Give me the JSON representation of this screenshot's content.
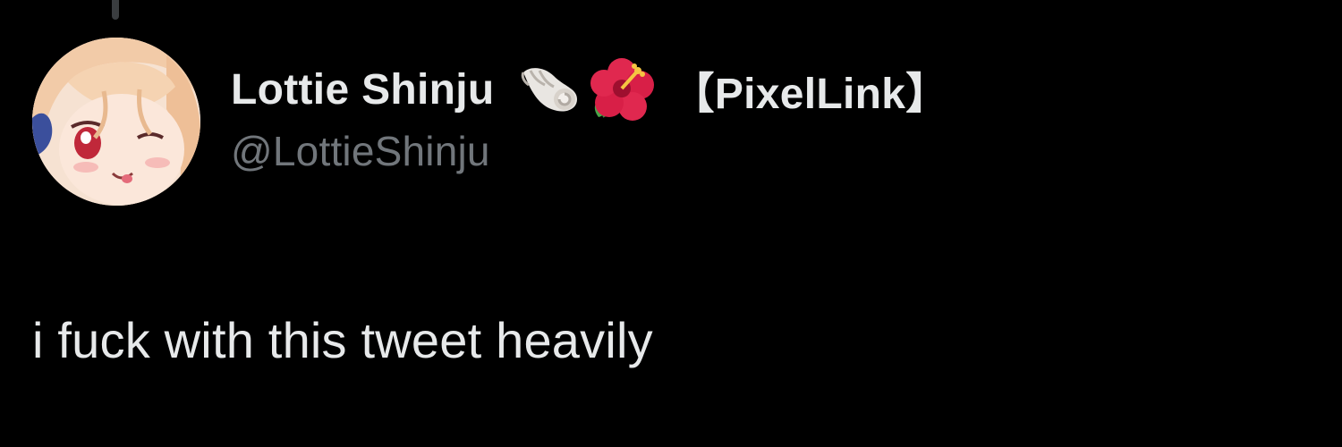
{
  "thread": {
    "connector_color": "#3a3d40"
  },
  "tweet": {
    "author": {
      "display_name": "Lottie Shinju",
      "name_emojis": [
        "spiral-shell-icon",
        "hibiscus-icon"
      ],
      "name_tag": "【PixelLink】",
      "handle": "@LottieShinju",
      "avatar": "avatar-image"
    },
    "text": "i fuck with this tweet heavily"
  },
  "colors": {
    "background": "#000000",
    "primary_text": "#e7e9ea",
    "secondary_text": "#71767b"
  }
}
